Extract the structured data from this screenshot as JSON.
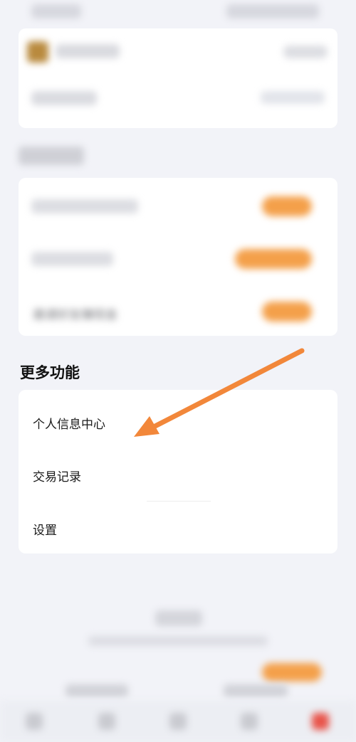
{
  "top": {
    "left_status": "",
    "right_status": "",
    "account_name": "",
    "account_action": "",
    "account_row_label": "",
    "account_row_value": ""
  },
  "welfare": {
    "title": "",
    "items": [
      {
        "label": "",
        "button": ""
      },
      {
        "label": "",
        "button": ""
      },
      {
        "label": "邀请好友赚现金",
        "button": ""
      }
    ]
  },
  "more": {
    "title": "更多功能",
    "items": [
      {
        "label": "个人信息中心"
      },
      {
        "label": "交易记录"
      },
      {
        "label": "设置"
      }
    ]
  },
  "footer": {
    "title": "",
    "subtitle": "",
    "promo_button": "",
    "left_link": "",
    "right_link": ""
  },
  "annotation": {
    "arrow_color": "#f2873a",
    "points_to": "个人信息中心"
  },
  "colors": {
    "background": "#f2f3f8",
    "accent": "#f4a04a",
    "tab_active": "#e8544a"
  },
  "bottom_nav": {
    "tabs": [
      {
        "icon": "home-icon"
      },
      {
        "icon": "grid-icon"
      },
      {
        "icon": "chat-icon"
      },
      {
        "icon": "wallet-icon"
      },
      {
        "icon": "profile-icon"
      }
    ]
  }
}
